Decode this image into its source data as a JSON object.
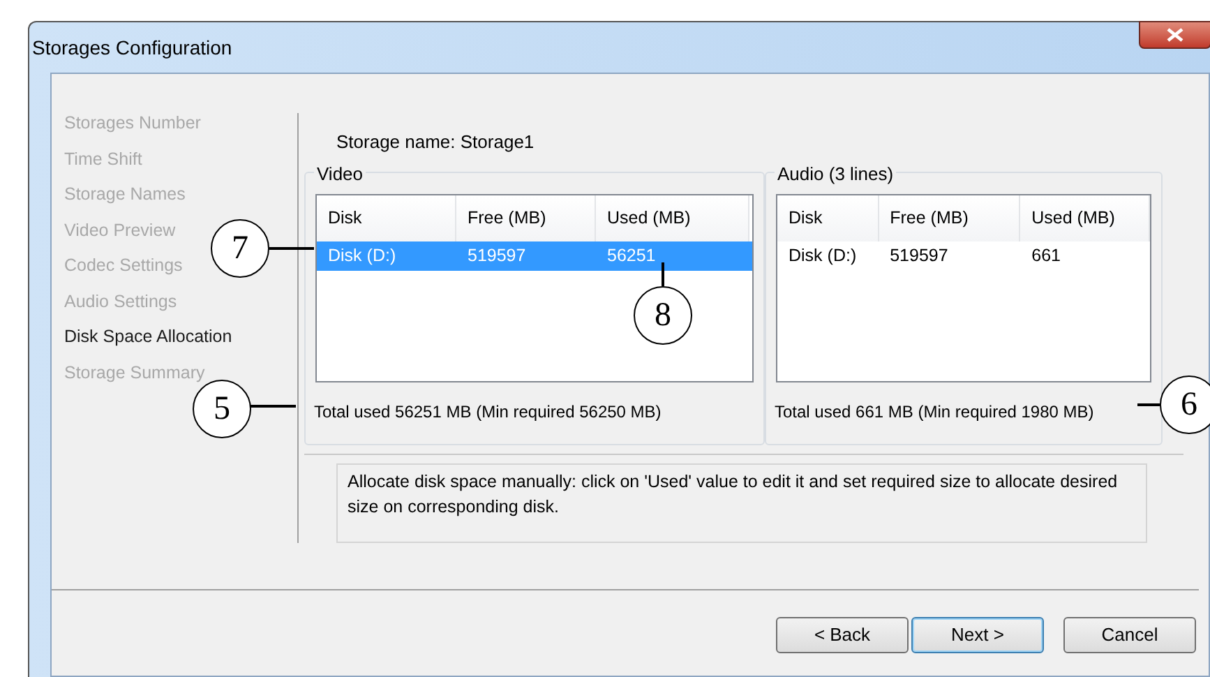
{
  "window": {
    "title": "Storages Configuration"
  },
  "steps": [
    {
      "label": "Storages Number",
      "selected": false
    },
    {
      "label": "Time Shift",
      "selected": false
    },
    {
      "label": "Storage Names",
      "selected": false
    },
    {
      "label": "Video Preview",
      "selected": false
    },
    {
      "label": "Codec Settings",
      "selected": false
    },
    {
      "label": "Audio Settings",
      "selected": false
    },
    {
      "label": "Disk Space Allocation",
      "selected": true
    },
    {
      "label": "Storage Summary",
      "selected": false
    }
  ],
  "storage_name": "Storage name: Storage1",
  "groups": [
    {
      "title": "Video",
      "columns": [
        "Disk",
        "Free (MB)",
        "Used (MB)"
      ],
      "rows": [
        {
          "cells": [
            "Disk (D:)",
            "519597",
            "56251"
          ],
          "selected": true
        }
      ],
      "total": "Total used 56251 MB (Min required 56250 MB)"
    },
    {
      "title": "Audio (3 lines)",
      "columns": [
        "Disk",
        "Free (MB)",
        "Used (MB)"
      ],
      "rows": [
        {
          "cells": [
            "Disk (D:)",
            "519597",
            "661"
          ],
          "selected": false
        }
      ],
      "total": "Total used 661 MB (Min required 1980 MB)"
    }
  ],
  "info": "Allocate disk space manually: click on 'Used' value to edit it and set required size to allocate desired size on corresponding disk.",
  "buttons": [
    {
      "label": "< Back",
      "default": false
    },
    {
      "label": "Next >",
      "default": true
    },
    {
      "label": "Cancel",
      "default": false
    }
  ],
  "callouts": [
    {
      "label": "7"
    },
    {
      "label": "8"
    },
    {
      "label": "5"
    },
    {
      "label": "6"
    }
  ]
}
